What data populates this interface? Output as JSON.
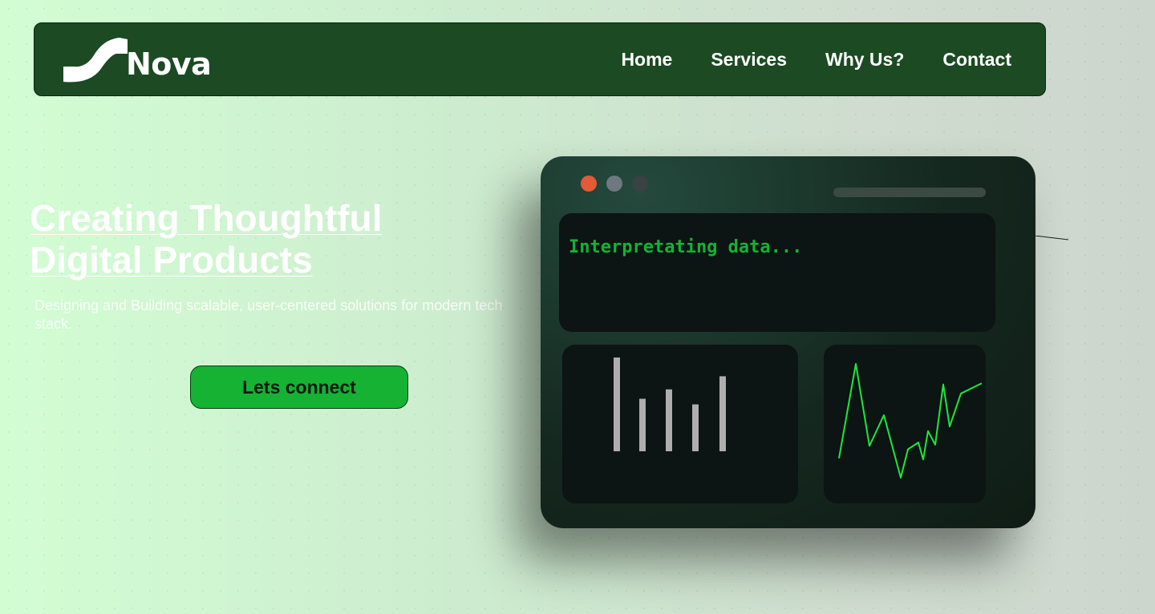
{
  "nav": {
    "logo_text": "Nova",
    "links": [
      "Home",
      "Services",
      "Why Us?",
      "Contact"
    ]
  },
  "hero": {
    "title_line1": "Creating Thoughtful",
    "title_line2": "Digital Products",
    "subtitle": "Designing and Building scalable, user-centered solutions for modern tech stack.",
    "cta_label": "Lets connect"
  },
  "dashboard": {
    "terminal_text": "Interpretating data...",
    "bar_values": [
      100,
      56,
      66,
      50,
      80
    ],
    "line_values": [
      17,
      100,
      28,
      55,
      0,
      25,
      31,
      16,
      41,
      29,
      82,
      45,
      74,
      83
    ]
  },
  "colors": {
    "nav_bg": "#1b4a23",
    "accent_green": "#15b233",
    "line_green": "#1ee83a",
    "bar_gray": "#aeaeae",
    "dot_red": "#e45a35"
  }
}
